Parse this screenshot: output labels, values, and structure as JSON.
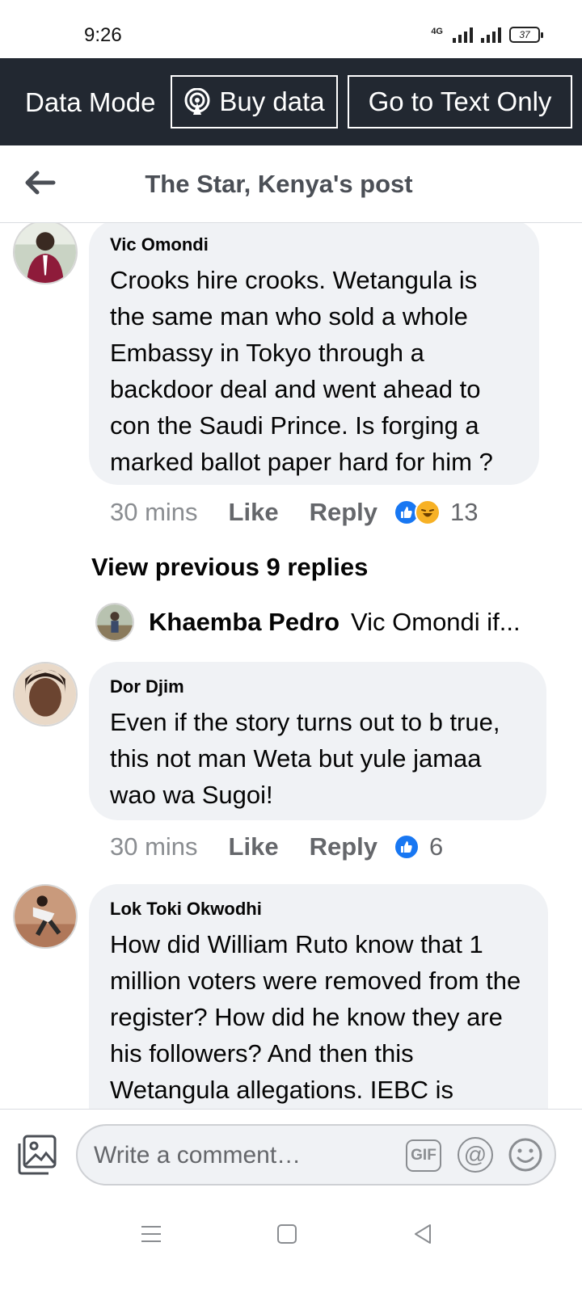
{
  "status_bar": {
    "time": "9:26",
    "network": "4G",
    "battery": "37"
  },
  "data_bar": {
    "mode_label": "Data Mode",
    "buy_label": "Buy data",
    "text_only_label": "Go to Text Only"
  },
  "header": {
    "title": "The Star, Kenya's post"
  },
  "comments": [
    {
      "author": "Vic Omondi",
      "text": "Crooks hire crooks. Wetangula is the same man who sold a whole Embassy in Tokyo through a backdoor deal and went ahead to con the Saudi Prince. Is forging a marked ballot paper hard for him ?",
      "time": "30 mins",
      "like": "Like",
      "reply": "Reply",
      "reactions": [
        "like-icon",
        "haha-icon"
      ],
      "reaction_count": "13"
    },
    {
      "author": "Dor Djim",
      "text": "Even if the story turns out to b true, this not man Weta but yule jamaa wao wa Sugoi!",
      "time": "30 mins",
      "like": "Like",
      "reply": "Reply",
      "reactions": [
        "like-icon"
      ],
      "reaction_count": "6"
    },
    {
      "author": "Lok Toki Okwodhi",
      "text": "How did William Ruto know that 1 million voters were removed from the register? How did he know they are his followers? And then this Wetangula allegations. IEBC is"
    }
  ],
  "thread": {
    "view_previous": "View previous 9 replies",
    "reply_author": "Khaemba Pedro",
    "reply_snippet": "Vic Omondi if..."
  },
  "composer": {
    "placeholder": "Write a comment…",
    "gif_label": "GIF",
    "at_label": "@"
  },
  "colors": {
    "data_bar_bg": "#222831",
    "bubble_bg": "#f0f2f5",
    "like_blue": "#1877f2",
    "haha_yellow": "#f7b125"
  }
}
